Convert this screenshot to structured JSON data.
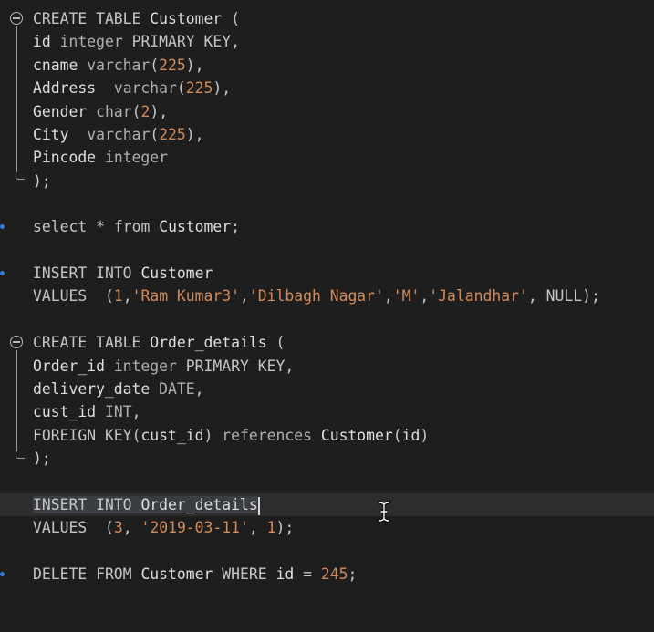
{
  "editor": {
    "language": "SQL",
    "colors": {
      "background": "#1e1e1e",
      "current_line": "#2d2d2d",
      "string": "#d28b59",
      "gutter_marker": "#2e7bd6"
    },
    "blocks": {
      "create_customer": {
        "l1": {
          "kw": "CREATE TABLE",
          "name": "Customer",
          "open": "("
        },
        "l2": {
          "col": "id",
          "type": "integer",
          "kw": "PRIMARY KEY",
          "end": ","
        },
        "l3": {
          "col": "cname",
          "type": "varchar",
          "open": "(",
          "num": "225",
          "close": "),"
        },
        "l4": {
          "col": "Address",
          "type": "varchar",
          "open": "(",
          "num": "225",
          "close": "),"
        },
        "l5": {
          "col": "Gender",
          "type": "char",
          "open": "(",
          "num": "2",
          "close": "),"
        },
        "l6": {
          "col": "City",
          "type": "varchar",
          "open": "(",
          "num": "225",
          "close": "),"
        },
        "l7": {
          "col": "Pincode",
          "type": "integer"
        },
        "l8": {
          "close": ");"
        }
      },
      "select_customer": {
        "kw1": "select",
        "star": "*",
        "kw2": "from",
        "name": "Customer",
        "end": ";"
      },
      "insert_customer": {
        "l1": {
          "kw": "INSERT INTO",
          "name": "Customer"
        },
        "l2": {
          "kw": "VALUES",
          "open": "(",
          "v1": "1",
          "s1": "'Ram Kumar3'",
          "s2": "'Dilbagh Nagar'",
          "s3": "'M'",
          "s4": "'Jalandhar'",
          "nul": "NULL",
          "comma": ",",
          "comma_sp": ", ",
          "close": ");"
        }
      },
      "create_order": {
        "l1": {
          "kw": "CREATE TABLE",
          "name": "Order_details",
          "open": "("
        },
        "l2": {
          "col": "Order_id",
          "type": "integer",
          "kw": "PRIMARY KEY",
          "end": ","
        },
        "l3": {
          "col": "delivery_date",
          "type": "DATE",
          "end": ","
        },
        "l4": {
          "col": "cust_id",
          "type": "INT",
          "end": ","
        },
        "l5": {
          "kw": "FOREIGN KEY",
          "open": "(",
          "col": "cust_id",
          "close": ")",
          "ref": "references",
          "name": "Customer",
          "open2": "(",
          "col2": "id",
          "close2": ")"
        },
        "l6": {
          "close": ");"
        }
      },
      "insert_order": {
        "l1": {
          "kw": "INSERT INTO",
          "name": "Order_details"
        },
        "l2": {
          "kw": "VALUES",
          "open": "(",
          "v1": "3",
          "s1": "'2019-03-11'",
          "v2": "1",
          "comma_sp": ", ",
          "close": ");"
        }
      },
      "delete_customer": {
        "kw1": "DELETE FROM",
        "name": "Customer",
        "kw2": "WHERE",
        "col": "id",
        "op": "=",
        "num": "245",
        "end": ";"
      }
    },
    "icons": {
      "fold": "fold-collapse-icon",
      "marker": "line-marker-icon",
      "cursor": "text-cursor-icon"
    }
  }
}
